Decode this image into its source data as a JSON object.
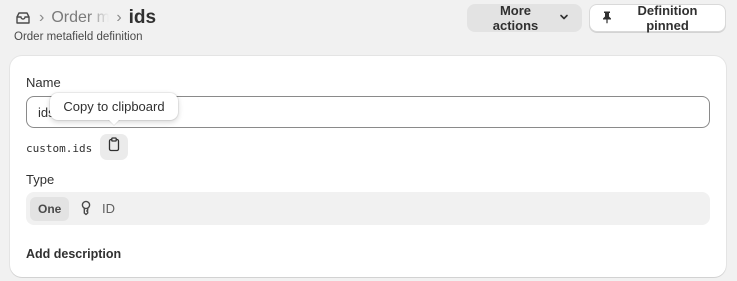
{
  "breadcrumb": {
    "root_icon": "metafields-icon",
    "parent_label": "Order metafields",
    "separator": "›"
  },
  "page": {
    "title": "ids",
    "subtitle": "Order metafield definition"
  },
  "actions": {
    "more_label": "More actions",
    "more_icon": "chevron-down-icon",
    "pin_label": "Definition pinned",
    "pin_icon": "pin-icon"
  },
  "form": {
    "name_label": "Name",
    "name_value": "ids",
    "namespace_key": "custom.ids",
    "copy_tooltip": "Copy to clipboard",
    "type_label": "Type",
    "type_cardinality": "One",
    "type_icon": "key-icon",
    "type_value": "ID",
    "add_description": "Add description"
  }
}
